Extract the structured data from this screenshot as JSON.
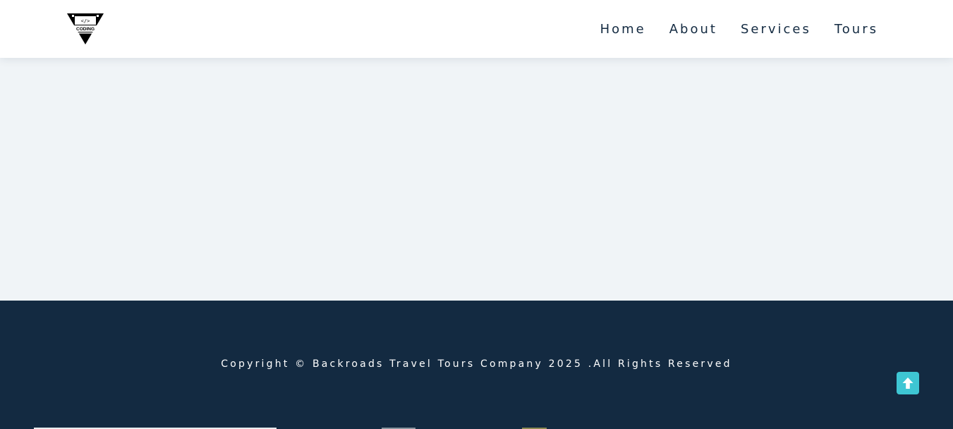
{
  "brand": {
    "logo_icon": "coding-logo-icon",
    "logo_text": "CODING"
  },
  "nav": {
    "items": [
      {
        "label": "Home"
      },
      {
        "label": "About"
      },
      {
        "label": "Services"
      },
      {
        "label": "Tours"
      }
    ]
  },
  "footer": {
    "copyright": "Copyright © Backroads Travel Tours Company 2025 .All Rights Reserved",
    "scroll_top_icon": "arrow-up-icon"
  },
  "colors": {
    "nav_text": "#132a41",
    "page_background": "#f0f4f7",
    "footer_background": "#132a41",
    "accent": "#3ec6d3"
  }
}
